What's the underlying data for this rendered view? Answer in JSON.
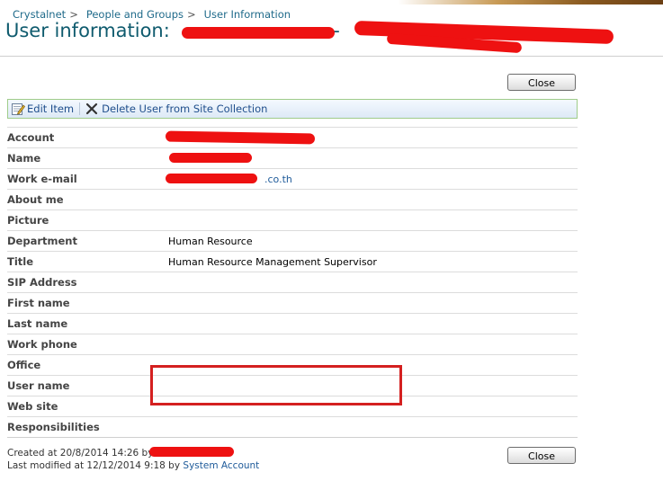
{
  "breadcrumb": {
    "items": [
      "Crystalnet",
      "People and Groups",
      "User Information"
    ],
    "separator": ">"
  },
  "header": {
    "title_prefix": "User information:",
    "title_suffix": "-"
  },
  "buttons": {
    "close_label": "Close"
  },
  "toolbar": {
    "edit_label": "Edit Item",
    "delete_label": "Delete User from Site Collection"
  },
  "fields": [
    {
      "label": "Account",
      "value": ""
    },
    {
      "label": "Name",
      "value": ""
    },
    {
      "label": "Work e-mail",
      "value": ".co.th"
    },
    {
      "label": "About me",
      "value": ""
    },
    {
      "label": "Picture",
      "value": ""
    },
    {
      "label": "Department",
      "value": "Human Resource"
    },
    {
      "label": "Title",
      "value": "Human Resource Management Supervisor"
    },
    {
      "label": "SIP Address",
      "value": ""
    },
    {
      "label": "First name",
      "value": ""
    },
    {
      "label": "Last name",
      "value": ""
    },
    {
      "label": "Work phone",
      "value": ""
    },
    {
      "label": "Office",
      "value": ""
    },
    {
      "label": "User name",
      "value": ""
    },
    {
      "label": "Web site",
      "value": ""
    },
    {
      "label": "Responsibilities",
      "value": ""
    }
  ],
  "footer": {
    "created_prefix": "Created at 20/8/2014 14:26  by",
    "modified_prefix": "Last modified at 12/12/2014 9:18  by",
    "modified_by": "System Account"
  },
  "colors": {
    "redaction": "#ee1111",
    "title": "#0f5b6e",
    "link": "#1f5b9a",
    "highlight_box": "#d42020"
  }
}
